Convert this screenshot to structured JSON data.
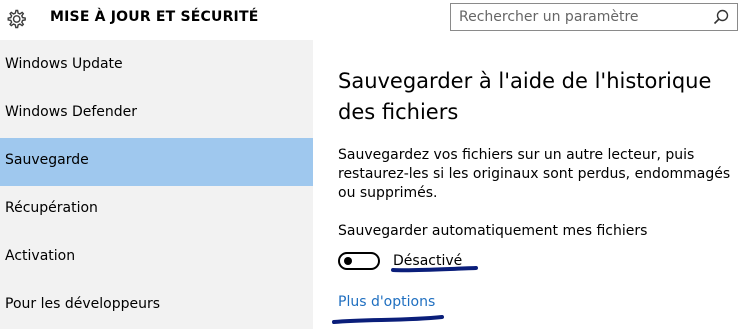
{
  "header": {
    "title": "MISE À JOUR ET SÉCURITÉ",
    "icon": "gear-icon"
  },
  "search": {
    "placeholder": "Rechercher un paramètre",
    "icon": "search-icon"
  },
  "sidebar": {
    "items": [
      {
        "label": "Windows Update"
      },
      {
        "label": "Windows Defender"
      },
      {
        "label": "Sauvegarde",
        "selected": true
      },
      {
        "label": "Récupération"
      },
      {
        "label": "Activation"
      },
      {
        "label": "Pour les développeurs"
      }
    ]
  },
  "main": {
    "title": "Sauvegarder à l'aide de l'historique des fichiers",
    "description": "Sauvegardez vos fichiers sur un autre lecteur, puis restaurez-les si les originaux sont perdus, endommagés ou supprimés.",
    "auto_backup_label": "Sauvegarder automatiquement mes fichiers",
    "toggle_state": "Désactivé",
    "toggle_on": false,
    "more_options": "Plus d'options"
  },
  "colors": {
    "selected_item": "#9fc8ee",
    "sidebar_bg": "#f2f2f2",
    "link": "#1f6fc0",
    "annotation_marker": "#0a1e7a"
  }
}
